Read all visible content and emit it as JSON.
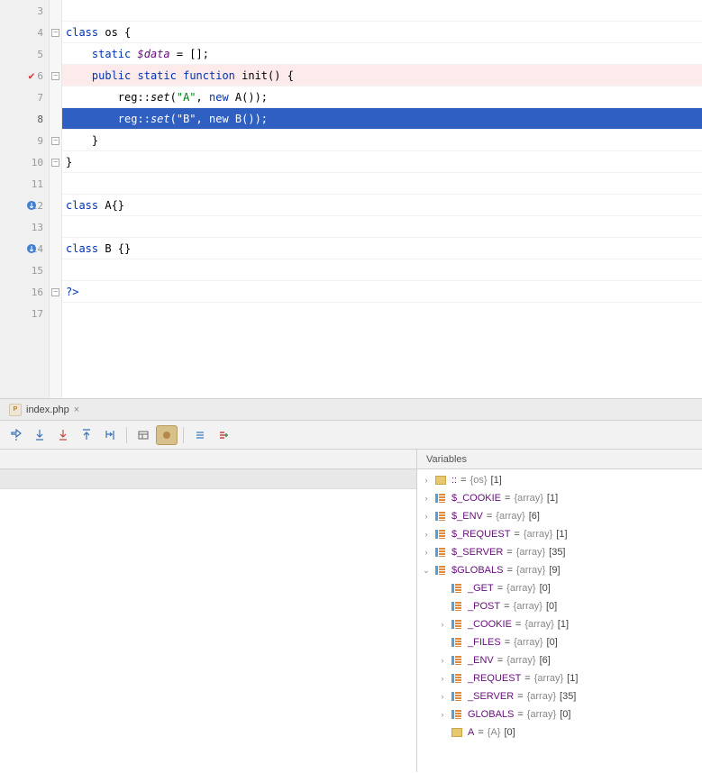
{
  "editor": {
    "lines": [
      {
        "num": "3"
      },
      {
        "num": "4"
      },
      {
        "num": "5"
      },
      {
        "num": "6"
      },
      {
        "num": "7"
      },
      {
        "num": "8"
      },
      {
        "num": "9"
      },
      {
        "num": "10"
      },
      {
        "num": "11"
      },
      {
        "num": "12"
      },
      {
        "num": "13"
      },
      {
        "num": "14"
      },
      {
        "num": "15"
      },
      {
        "num": "16"
      },
      {
        "num": "17"
      }
    ],
    "l4_class": "class",
    "l4_name": "os",
    "l4_brace": " {",
    "l5_static": "static",
    "l5_var": "$data",
    "l5_rest": " = [];",
    "l6_public": "public",
    "l6_static": "static",
    "l6_function": "function",
    "l6_name": "init",
    "l6_rest": "() {",
    "l7_reg": "reg",
    "l7_sep": "::",
    "l7_set": "set",
    "l7_p1": "(",
    "l7_str": "\"A\"",
    "l7_c": ", ",
    "l7_new": "new",
    "l7_a": " A());",
    "l8_reg": "reg",
    "l8_sep": "::",
    "l8_set": "set",
    "l8_p1": "(",
    "l8_str": "\"B\"",
    "l8_c": ", ",
    "l8_new": "new",
    "l8_b": " B());",
    "l9": "    }",
    "l10": "}",
    "l12_class": "class",
    "l12_name": " A{}",
    "l14_class": "class",
    "l14_name": " B {}",
    "l16": "?>"
  },
  "file_tab": {
    "name": "index.php",
    "icon_text": "P"
  },
  "variables_panel": {
    "title": "Variables",
    "items": [
      {
        "indent": 0,
        "arrow": "right",
        "icon": "obj",
        "name": ":: ",
        "eq": "= ",
        "type": "{os}",
        "count": " [1]"
      },
      {
        "indent": 0,
        "arrow": "right",
        "icon": "arr",
        "name": "$_COOKIE ",
        "eq": "= ",
        "type": "{array}",
        "count": " [1]"
      },
      {
        "indent": 0,
        "arrow": "right",
        "icon": "arr",
        "name": "$_ENV ",
        "eq": "= ",
        "type": "{array}",
        "count": " [6]"
      },
      {
        "indent": 0,
        "arrow": "right",
        "icon": "arr",
        "name": "$_REQUEST ",
        "eq": "= ",
        "type": "{array}",
        "count": " [1]"
      },
      {
        "indent": 0,
        "arrow": "right",
        "icon": "arr",
        "name": "$_SERVER ",
        "eq": "= ",
        "type": "{array}",
        "count": " [35]"
      },
      {
        "indent": 0,
        "arrow": "down",
        "icon": "arr",
        "name": "$GLOBALS ",
        "eq": "= ",
        "type": "{array}",
        "count": " [9]"
      },
      {
        "indent": 1,
        "arrow": "blank",
        "icon": "arr",
        "name": "_GET ",
        "eq": "= ",
        "type": "{array}",
        "count": " [0]"
      },
      {
        "indent": 1,
        "arrow": "blank",
        "icon": "arr",
        "name": "_POST ",
        "eq": "= ",
        "type": "{array}",
        "count": " [0]"
      },
      {
        "indent": 1,
        "arrow": "right",
        "icon": "arr",
        "name": "_COOKIE ",
        "eq": "= ",
        "type": "{array}",
        "count": " [1]"
      },
      {
        "indent": 1,
        "arrow": "blank",
        "icon": "arr",
        "name": "_FILES ",
        "eq": "= ",
        "type": "{array}",
        "count": " [0]"
      },
      {
        "indent": 1,
        "arrow": "right",
        "icon": "arr",
        "name": "_ENV ",
        "eq": "= ",
        "type": "{array}",
        "count": " [6]"
      },
      {
        "indent": 1,
        "arrow": "right",
        "icon": "arr",
        "name": "_REQUEST ",
        "eq": "= ",
        "type": "{array}",
        "count": " [1]"
      },
      {
        "indent": 1,
        "arrow": "right",
        "icon": "arr",
        "name": "_SERVER ",
        "eq": "= ",
        "type": "{array}",
        "count": " [35]"
      },
      {
        "indent": 1,
        "arrow": "right",
        "icon": "arr",
        "name": "GLOBALS ",
        "eq": "= ",
        "type": "{array}",
        "count": " [0]"
      },
      {
        "indent": 1,
        "arrow": "blank",
        "icon": "obj",
        "name": "A ",
        "eq": "= ",
        "type": "{A}",
        "count": " [0]"
      }
    ]
  }
}
